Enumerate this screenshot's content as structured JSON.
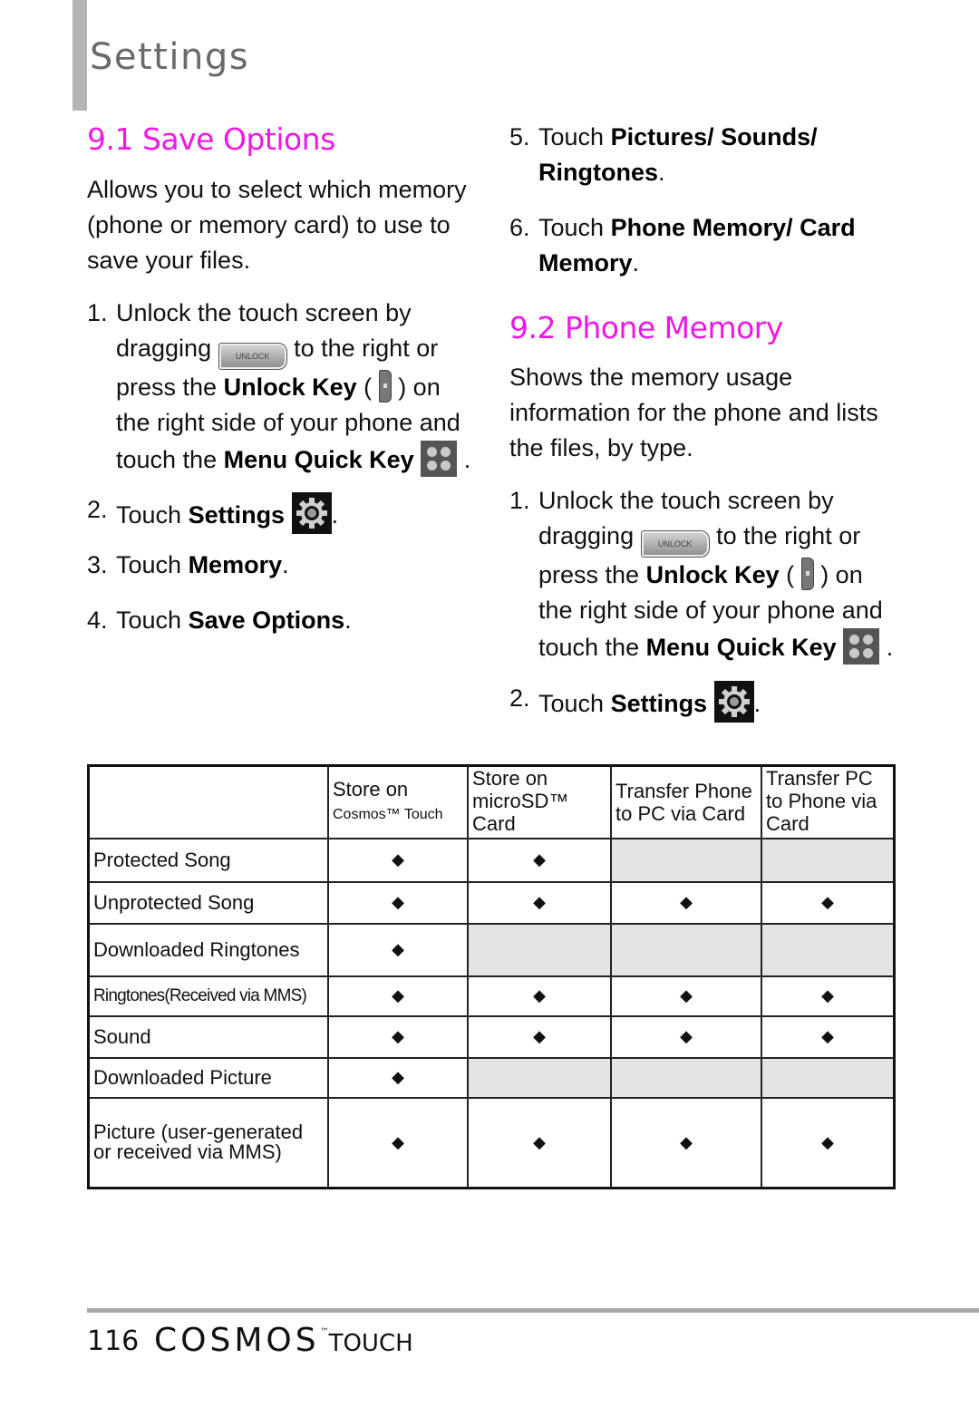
{
  "header": {
    "title": "Settings"
  },
  "section1": {
    "title": "9.1 Save Options",
    "intro": "Allows you to select which memory (phone or memory card) to use to save your files.",
    "steps": [
      {
        "num": "1.",
        "parts": [
          "Unlock the touch screen by dragging",
          "to the right or press the",
          "Unlock Key",
          "(",
          ") on the right side of your phone and touch the",
          "Menu Quick Key",
          "."
        ]
      },
      {
        "num": "2.",
        "pre": "Touch ",
        "bold": "Settings",
        "post": "."
      },
      {
        "num": "3.",
        "pre": "Touch ",
        "bold": "Memory",
        "post": "."
      },
      {
        "num": "4.",
        "pre": "Touch ",
        "bold": "Save Options",
        "post": "."
      },
      {
        "num": "5.",
        "pre": "Touch ",
        "bold": "Pictures/ Sounds/ Ringtones",
        "post": "."
      },
      {
        "num": "6.",
        "pre": "Touch ",
        "bold": "Phone Memory/ Card Memory",
        "post": "."
      }
    ]
  },
  "section2": {
    "title": "9.2 Phone Memory",
    "intro": "Shows the memory usage information for the phone and lists the files, by type.",
    "steps": [
      {
        "num": "1.",
        "parts": [
          "Unlock the touch screen by dragging",
          "to the right or press the",
          "Unlock Key",
          "(",
          ") on the right side of your phone and touch the",
          "Menu Quick Key",
          "."
        ]
      },
      {
        "num": "2.",
        "pre": "Touch ",
        "bold": "Settings",
        "post": "."
      }
    ]
  },
  "icons": {
    "unlock_slider_label": "UNLOCK"
  },
  "table": {
    "headers": [
      {
        "line1": "",
        "line2": ""
      },
      {
        "line1": "Store on",
        "line2": "Cosmos™ Touch"
      },
      {
        "line1": "Store on microSD™ Card",
        "line2": ""
      },
      {
        "line1": "Transfer Phone to PC via Card",
        "line2": ""
      },
      {
        "line1": "Transfer PC to Phone via Card",
        "line2": ""
      }
    ],
    "rows": [
      {
        "label": "Protected Song",
        "cells": [
          true,
          true,
          false,
          false
        ]
      },
      {
        "label": "Unprotected Song",
        "cells": [
          true,
          true,
          true,
          true
        ]
      },
      {
        "label": "Downloaded Ringtones",
        "cells": [
          true,
          false,
          false,
          false
        ]
      },
      {
        "label": "Ringtones(Received via MMS)",
        "cells": [
          true,
          true,
          true,
          true
        ]
      },
      {
        "label": "Sound",
        "cells": [
          true,
          true,
          true,
          true
        ]
      },
      {
        "label": "Downloaded Picture",
        "cells": [
          true,
          false,
          false,
          false
        ]
      },
      {
        "label": "Picture (user-generated or received via MMS)",
        "cells": [
          true,
          true,
          true,
          true
        ]
      }
    ],
    "mark_symbol": "◆",
    "na_color": "#e4e4e4"
  },
  "footer": {
    "page_number": "116",
    "brand": "COSMOS",
    "brand_tm": "™",
    "brand_suffix": "TOUCH"
  },
  "colors": {
    "section_title": "#ee18e6",
    "header_bar": "#b4b4b4",
    "header_text": "#6a6a6a"
  }
}
